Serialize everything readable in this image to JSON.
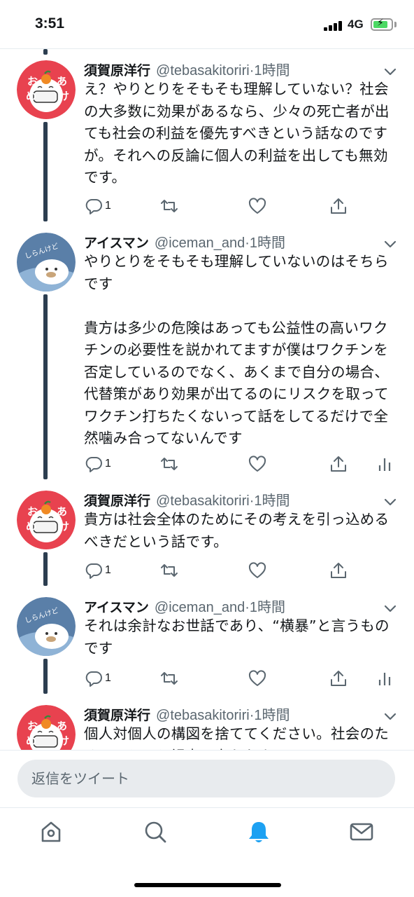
{
  "status_bar": {
    "time": "3:51",
    "network": "4G"
  },
  "tweets": [
    {
      "avatar": {
        "type": "orange",
        "chars": [
          "お",
          "め",
          "あ",
          "け"
        ]
      },
      "name": "須賀原洋行",
      "handle": "@tebasakitoriri",
      "time": "·1時間",
      "text": "え？やりとりをそもそも理解していない？社会の大多数に効果があるなら、少々の死亡者が出ても社会の利益を優先すべきという話なのですが。それへの反論に個人の利益を出しても無効です。",
      "reply_count": "1",
      "show_analytics": false
    },
    {
      "avatar": {
        "type": "seal",
        "text": "しらんけど"
      },
      "name": "アイスマン",
      "handle": "@iceman_and",
      "time": "·1時間",
      "text": "やりとりをそもそも理解していないのはそちらです\n\n貴方は多少の危険はあっても公益性の高いワクチンの必要性を説かれてますが僕はワクチンを否定しているのでなく、あくまで自分の場合、代替策があり効果が出てるのにリスクを取ってワクチン打ちたくないって話をしてるだけで全然噛み合ってないんです",
      "reply_count": "1",
      "show_analytics": true
    },
    {
      "avatar": {
        "type": "orange",
        "chars": [
          "お",
          "め",
          "あ",
          "け"
        ]
      },
      "name": "須賀原洋行",
      "handle": "@tebasakitoriri",
      "time": "·1時間",
      "text": "貴方は社会全体のためにその考えを引っ込めるべきだという話です。",
      "reply_count": "1",
      "show_analytics": false
    },
    {
      "avatar": {
        "type": "seal",
        "text": "しらんけど"
      },
      "name": "アイスマン",
      "handle": "@iceman_and",
      "time": "·1時間",
      "text": "それは余計なお世話であり、“横暴”と言うものです",
      "reply_count": "1",
      "show_analytics": true
    },
    {
      "avatar": {
        "type": "orange",
        "chars": [
          "お",
          "め",
          "あ",
          "け"
        ]
      },
      "name": "須賀原洋行",
      "handle": "@tebasakitoriri",
      "time": "·1時間",
      "text": "個人対個人の構図を捨ててください。社会のために、という視点に立たなきゃ。",
      "reply_count": "",
      "show_analytics": false
    }
  ],
  "reply_bar": {
    "placeholder": "返信をツイート"
  },
  "tab_bar": {
    "tabs": [
      "home-icon",
      "search-icon",
      "notifications-icon",
      "messages-icon"
    ],
    "active": "notifications-icon"
  },
  "colors": {
    "accent": "#1da1f2",
    "thread_line": "#2c3e50",
    "orange_avatar_bg": "#e8424f",
    "seal_avatar_bg": "#5a7fa8"
  }
}
